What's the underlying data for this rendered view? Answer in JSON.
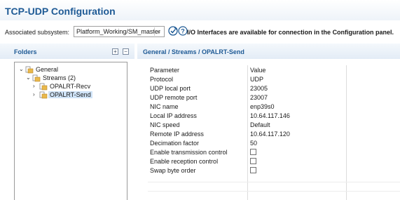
{
  "title": "TCP-UDP Configuration",
  "subsystem": {
    "label": "Associated subsystem:",
    "selected": "Platform_Working/SM_master",
    "message": "I/O Interfaces are available for connection in the Configuration panel."
  },
  "folders": {
    "header": "Folders",
    "tree": [
      {
        "label": "General",
        "expanded": true
      },
      {
        "label": "Streams (2)",
        "expanded": true
      },
      {
        "label": "OPALRT-Recv"
      },
      {
        "label": "OPALRT-Send",
        "selected": true
      }
    ]
  },
  "details": {
    "breadcrumb": "General / Streams  / OPALRT-Send",
    "columns": [
      "Parameter",
      "Value"
    ],
    "rows": [
      {
        "param": "Protocol",
        "value": "UDP"
      },
      {
        "param": "UDP local port",
        "value": "23005"
      },
      {
        "param": "UDP remote port",
        "value": "23007"
      },
      {
        "param": "NIC name",
        "value": "enp39s0"
      },
      {
        "param": "Local IP address",
        "value": "10.64.117.146"
      },
      {
        "param": "NIC speed",
        "value": "Default"
      },
      {
        "param": "Remote IP address",
        "value": "10.64.117.120"
      },
      {
        "param": "Decimation factor",
        "value": "50"
      },
      {
        "param": "Enable transmission control",
        "checkbox": false
      },
      {
        "param": "Enable reception control",
        "checkbox": false
      },
      {
        "param": "Swap byte order",
        "checkbox": false
      }
    ]
  },
  "colors": {
    "accent": "#1e5a95",
    "header_bg": "#e3ecf6"
  }
}
